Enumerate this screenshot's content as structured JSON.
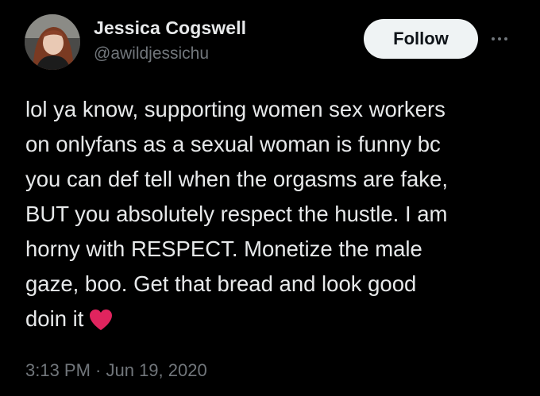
{
  "author": {
    "name": "Jessica Cogswell",
    "handle": "@awildjessichu"
  },
  "actions": {
    "follow_label": "Follow",
    "more_icon": "more-horizontal-icon"
  },
  "tweet": {
    "lines": [
      "lol ya know, supporting women sex workers",
      "on onlyfans as a sexual woman is funny bc",
      "you can def tell when the orgasms are fake,",
      "BUT you absolutely respect the hustle. I am",
      "horny with RESPECT. Monetize the male",
      "gaze, boo. Get that bread and look good",
      "doin it"
    ],
    "emoji": "red-heart-icon",
    "timestamp": "3:13 PM · Jun 19, 2020"
  },
  "colors": {
    "background": "#000000",
    "primary_text": "#e7e9ea",
    "secondary_text": "#71767b",
    "follow_bg": "#eff3f4",
    "heart": "#e0245e"
  }
}
